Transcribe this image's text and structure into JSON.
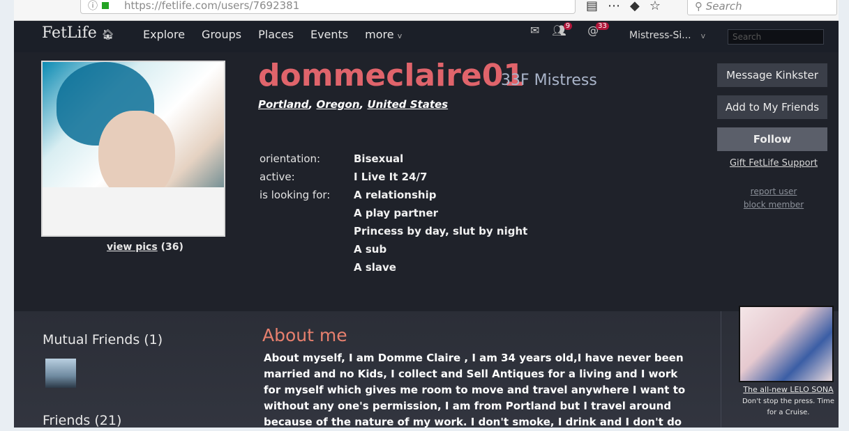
{
  "browser": {
    "url": "https://fetlife.com/users/7692381",
    "search_placeholder": "Search",
    "icons": [
      "reader-icon",
      "more-icon",
      "pocket-icon",
      "bookmark-star-icon"
    ]
  },
  "nav": {
    "logo": "FetLife",
    "links": [
      "Explore",
      "Groups",
      "Places",
      "Events",
      "more"
    ],
    "messages_icon": "envelope-icon",
    "requests_count": "9",
    "mentions_count": "33",
    "user_label": "Mistress-Si...",
    "search_placeholder": "Search"
  },
  "profile": {
    "username": "dommeclaire01",
    "age_role": "33F Mistress",
    "location": [
      "Portland",
      "Oregon",
      "United States"
    ],
    "view_pics_label": "view pics",
    "pics_count": "(36)",
    "details": [
      {
        "label": "orientation:",
        "value": "Bisexual"
      },
      {
        "label": "active:",
        "value": "I Live It 24/7"
      },
      {
        "label": "is looking for:",
        "value": "A relationship"
      }
    ],
    "looking_for_more": [
      "A play partner",
      "Princess by day, slut by night",
      "A sub",
      "A slave"
    ],
    "actions": {
      "message": "Message Kinkster",
      "add_friend": "Add to My Friends",
      "follow": "Follow",
      "gift": "Gift FetLife Support",
      "report": "report user",
      "block": "block member"
    }
  },
  "lower": {
    "mutual_friends": "Mutual Friends",
    "mutual_count": "(1)",
    "friends": "Friends",
    "friends_count": "(21)",
    "about_title": "About me",
    "about_text": "About myself, I am Domme Claire , I am 34 years old,I have never been married and no Kids, I collect and Sell Antiques for a living and I work for myself which gives me room to move and travel anywhere I want to without any one's permission, I am from Portland but I travel around because of the nature of my work. I don't smoke, I drink and I don't do",
    "ad_link": "The all-new LELO SONA",
    "ad_text": "Don't stop the press. Time for a Cruise."
  }
}
